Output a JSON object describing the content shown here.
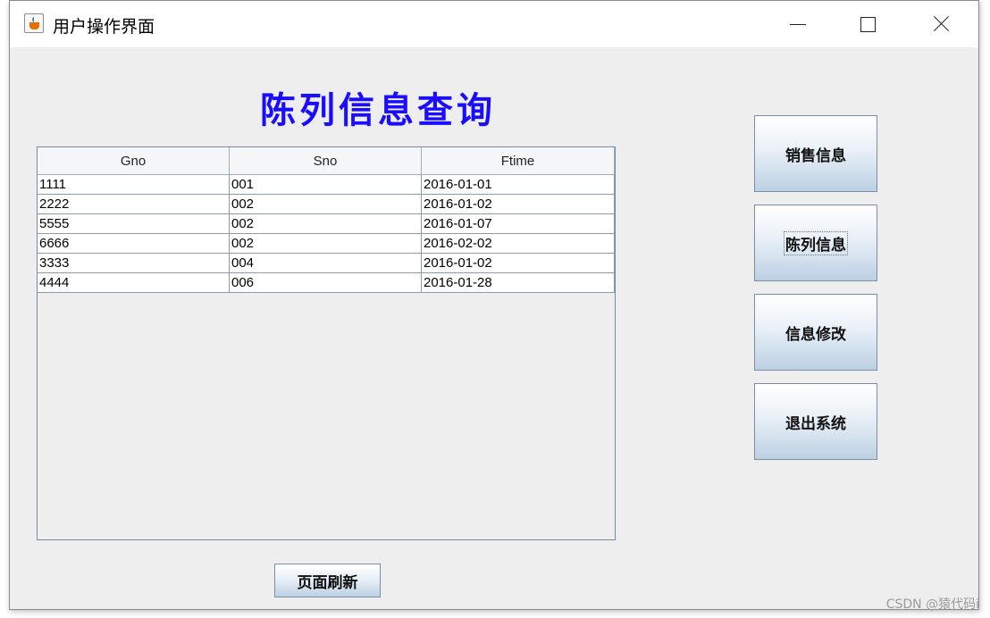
{
  "window": {
    "title": "用户操作界面",
    "icon": "java-icon"
  },
  "page": {
    "heading": "陈列信息查询",
    "heading_color": "#1a0dff"
  },
  "table": {
    "columns": [
      "Gno",
      "Sno",
      "Ftime"
    ],
    "rows": [
      [
        "1111",
        "001",
        "2016-01-01"
      ],
      [
        "2222",
        "002",
        "2016-01-02"
      ],
      [
        "5555",
        "002",
        "2016-01-07"
      ],
      [
        "6666",
        "002",
        "2016-02-02"
      ],
      [
        "3333",
        "004",
        "2016-01-02"
      ],
      [
        "4444",
        "006",
        "2016-01-28"
      ]
    ]
  },
  "sidebar": {
    "buttons": [
      {
        "label": "销售信息"
      },
      {
        "label": "陈列信息",
        "focused": true
      },
      {
        "label": "信息修改"
      },
      {
        "label": "退出系统"
      }
    ]
  },
  "footer": {
    "refresh_label": "页面刷新"
  },
  "watermark": "CSDN @猿代码i"
}
